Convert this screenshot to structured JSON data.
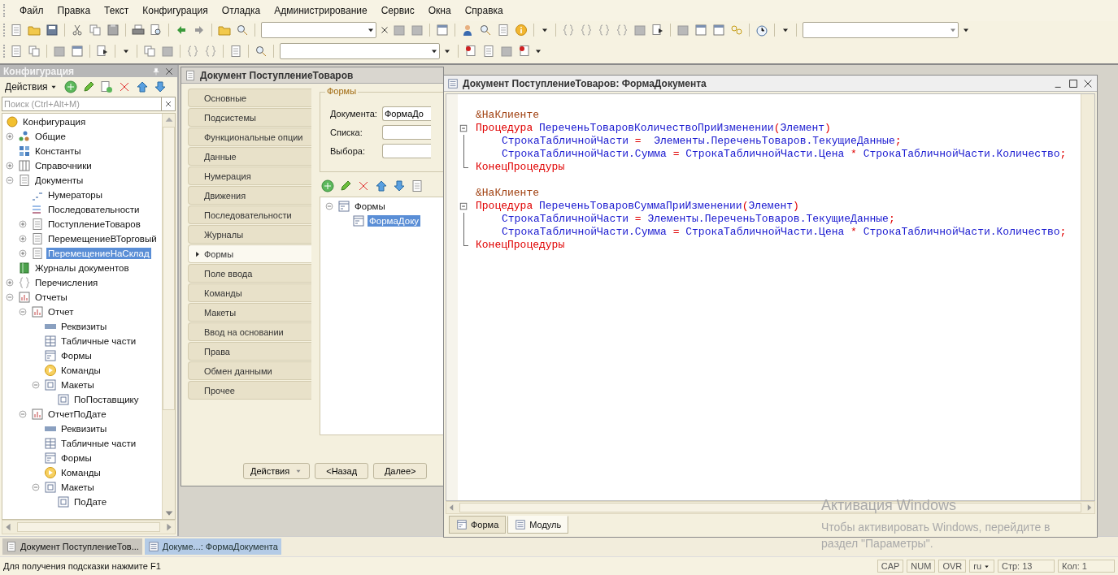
{
  "menu": [
    "Файл",
    "Правка",
    "Текст",
    "Конфигурация",
    "Отладка",
    "Администрирование",
    "Сервис",
    "Окна",
    "Справка"
  ],
  "config_panel": {
    "title": "Конфигурация",
    "actions_label": "Действия",
    "search": {
      "placeholder": "Поиск (Ctrl+Alt+M)"
    },
    "tree": [
      {
        "label": "Конфигурация",
        "kind": "config",
        "selected": false,
        "children": [
          {
            "label": "Общие",
            "kind": "common",
            "expanded": false,
            "selected": false
          },
          {
            "label": "Константы",
            "kind": "constants",
            "selected": false
          },
          {
            "label": "Справочники",
            "kind": "catalogs",
            "expanded": false,
            "selected": false
          },
          {
            "label": "Документы",
            "kind": "documents",
            "expanded": true,
            "selected": false,
            "children": [
              {
                "label": "Нумераторы",
                "kind": "numerators",
                "selected": false
              },
              {
                "label": "Последовательности",
                "kind": "sequences",
                "selected": false
              },
              {
                "label": "ПоступлениеТоваров",
                "kind": "documents",
                "expanded": false,
                "selected": false
              },
              {
                "label": "ПеремещениеВТорговый",
                "kind": "documents",
                "expanded": false,
                "selected": false
              },
              {
                "label": "ПеремещениеНаСклад",
                "kind": "documents",
                "expanded": false,
                "selected": true
              }
            ]
          },
          {
            "label": "Журналы документов",
            "kind": "journals",
            "selected": false
          },
          {
            "label": "Перечисления",
            "kind": "enums",
            "expanded": false,
            "selected": false
          },
          {
            "label": "Отчеты",
            "kind": "reports",
            "expanded": true,
            "selected": false,
            "children": [
              {
                "label": "Отчет",
                "kind": "reports",
                "expanded": true,
                "selected": false,
                "children": [
                  {
                    "label": "Реквизиты",
                    "kind": "attributes",
                    "selected": false
                  },
                  {
                    "label": "Табличные части",
                    "kind": "tables",
                    "selected": false
                  },
                  {
                    "label": "Формы",
                    "kind": "forms",
                    "selected": false
                  },
                  {
                    "label": "Команды",
                    "kind": "commands",
                    "selected": false
                  },
                  {
                    "label": "Макеты",
                    "kind": "templates",
                    "expanded": true,
                    "selected": false,
                    "children": [
                      {
                        "label": "ПоПоставщику",
                        "kind": "templates",
                        "selected": false
                      }
                    ]
                  }
                ]
              },
              {
                "label": "ОтчетПоДате",
                "kind": "reports",
                "expanded": true,
                "selected": false,
                "children": [
                  {
                    "label": "Реквизиты",
                    "kind": "attributes",
                    "selected": false
                  },
                  {
                    "label": "Табличные части",
                    "kind": "tables",
                    "selected": false
                  },
                  {
                    "label": "Формы",
                    "kind": "forms",
                    "selected": false
                  },
                  {
                    "label": "Команды",
                    "kind": "commands",
                    "selected": false
                  },
                  {
                    "label": "Макеты",
                    "kind": "templates",
                    "expanded": true,
                    "selected": false,
                    "children": [
                      {
                        "label": "ПоДате",
                        "kind": "templates",
                        "selected": false
                      }
                    ]
                  }
                ]
              }
            ]
          }
        ]
      }
    ]
  },
  "object_window": {
    "title": "Документ ПоступлениеТоваров",
    "tabs": [
      {
        "label": "Основные",
        "selected": false
      },
      {
        "label": "Подсистемы",
        "selected": false
      },
      {
        "label": "Функциональные опции",
        "selected": false
      },
      {
        "label": "Данные",
        "selected": false
      },
      {
        "label": "Нумерация",
        "selected": false
      },
      {
        "label": "Движения",
        "selected": false
      },
      {
        "label": "Последовательности",
        "selected": false
      },
      {
        "label": "Журналы",
        "selected": false
      },
      {
        "label": "Формы",
        "selected": true
      },
      {
        "label": "Поле ввода",
        "selected": false
      },
      {
        "label": "Команды",
        "selected": false
      },
      {
        "label": "Макеты",
        "selected": false
      },
      {
        "label": "Ввод на основании",
        "selected": false
      },
      {
        "label": "Права",
        "selected": false
      },
      {
        "label": "Обмен данными",
        "selected": false
      },
      {
        "label": "Прочее",
        "selected": false
      }
    ],
    "group_title": "Формы",
    "fields": [
      {
        "label": "Документа:",
        "value": "ФормаДо"
      },
      {
        "label": "Списка:"
      },
      {
        "label": "Выбора:"
      }
    ],
    "forms_tree": [
      {
        "label": "Формы",
        "expanded": true,
        "selected": false,
        "children": [
          {
            "label": "ФормаДоку",
            "selected": true
          }
        ]
      }
    ],
    "buttons": [
      {
        "label": "Действия",
        "kind": "dropdown"
      },
      {
        "label": "<Назад",
        "kind": "plain"
      },
      {
        "label": "Далее>",
        "kind": "plain"
      }
    ]
  },
  "module_window": {
    "title": "Документ ПоступлениеТоваров: ФормаДокумента",
    "procedures": [
      {
        "annotation": "&НаКлиенте",
        "header": [
          {
            "kind": "keyword",
            "text": "Процедура "
          },
          {
            "kind": "name",
            "text": "ПереченьТоваровКоличествоПриИзменении"
          },
          {
            "kind": "op",
            "text": "("
          },
          {
            "kind": "name",
            "text": "Элемент"
          },
          {
            "kind": "op",
            "text": ")"
          }
        ],
        "body": [
          [
            {
              "kind": "name",
              "text": "СтрокаТабличнойЧасти "
            },
            {
              "kind": "op",
              "text": "="
            },
            {
              "kind": "name",
              "text": "  Элементы.ПереченьТоваров.ТекущиеДанные"
            },
            {
              "kind": "op",
              "text": ";"
            }
          ],
          [
            {
              "kind": "name",
              "text": "СтрокаТабличнойЧасти.Сумма "
            },
            {
              "kind": "op",
              "text": "="
            },
            {
              "kind": "name",
              "text": " СтрокаТабличнойЧасти.Цена "
            },
            {
              "kind": "op",
              "text": "*"
            },
            {
              "kind": "name",
              "text": " СтрокаТабличнойЧасти.Количество"
            },
            {
              "kind": "op",
              "text": ";"
            }
          ]
        ],
        "end": [
          {
            "kind": "keyword",
            "text": "КонецПроцедуры"
          }
        ]
      },
      {
        "annotation": "&НаКлиенте",
        "header": [
          {
            "kind": "keyword",
            "text": "Процедура "
          },
          {
            "kind": "name",
            "text": "ПереченьТоваровСуммаПриИзменении"
          },
          {
            "kind": "op",
            "text": "("
          },
          {
            "kind": "name",
            "text": "Элемент"
          },
          {
            "kind": "op",
            "text": ")"
          }
        ],
        "body": [
          [
            {
              "kind": "name",
              "text": "СтрокаТабличнойЧасти "
            },
            {
              "kind": "op",
              "text": "="
            },
            {
              "kind": "name",
              "text": " Элементы.ПереченьТоваров.ТекущиеДанные"
            },
            {
              "kind": "op",
              "text": ";"
            }
          ],
          [
            {
              "kind": "name",
              "text": "СтрокаТабличнойЧасти.Сумма "
            },
            {
              "kind": "op",
              "text": "="
            },
            {
              "kind": "name",
              "text": " СтрокаТабличнойЧасти.Цена "
            },
            {
              "kind": "op",
              "text": "*"
            },
            {
              "kind": "name",
              "text": " СтрокаТабличнойЧасти.Количество"
            },
            {
              "kind": "op",
              "text": ";"
            }
          ]
        ],
        "end": [
          {
            "kind": "keyword",
            "text": "КонецПроцедуры"
          }
        ]
      }
    ],
    "tabs": [
      {
        "label": "Форма",
        "selected": false
      },
      {
        "label": "Модуль",
        "selected": true
      }
    ]
  },
  "activation_notice": {
    "title": "Активация Windows",
    "lines": [
      "Чтобы активировать Windows, перейдите в",
      "раздел \"Параметры\"."
    ]
  },
  "taskbar": [
    {
      "label": "Документ ПоступлениеТов...",
      "selected": false
    },
    {
      "label": "Докуме...: ФормаДокумента",
      "selected": true
    }
  ],
  "status_bar": {
    "hint": "Для получения подсказки нажмите F1",
    "indicators": [
      "CAP",
      "NUM",
      "OVR"
    ],
    "language": "ru",
    "line": "Стр: 13",
    "column": "Кол: 1"
  }
}
